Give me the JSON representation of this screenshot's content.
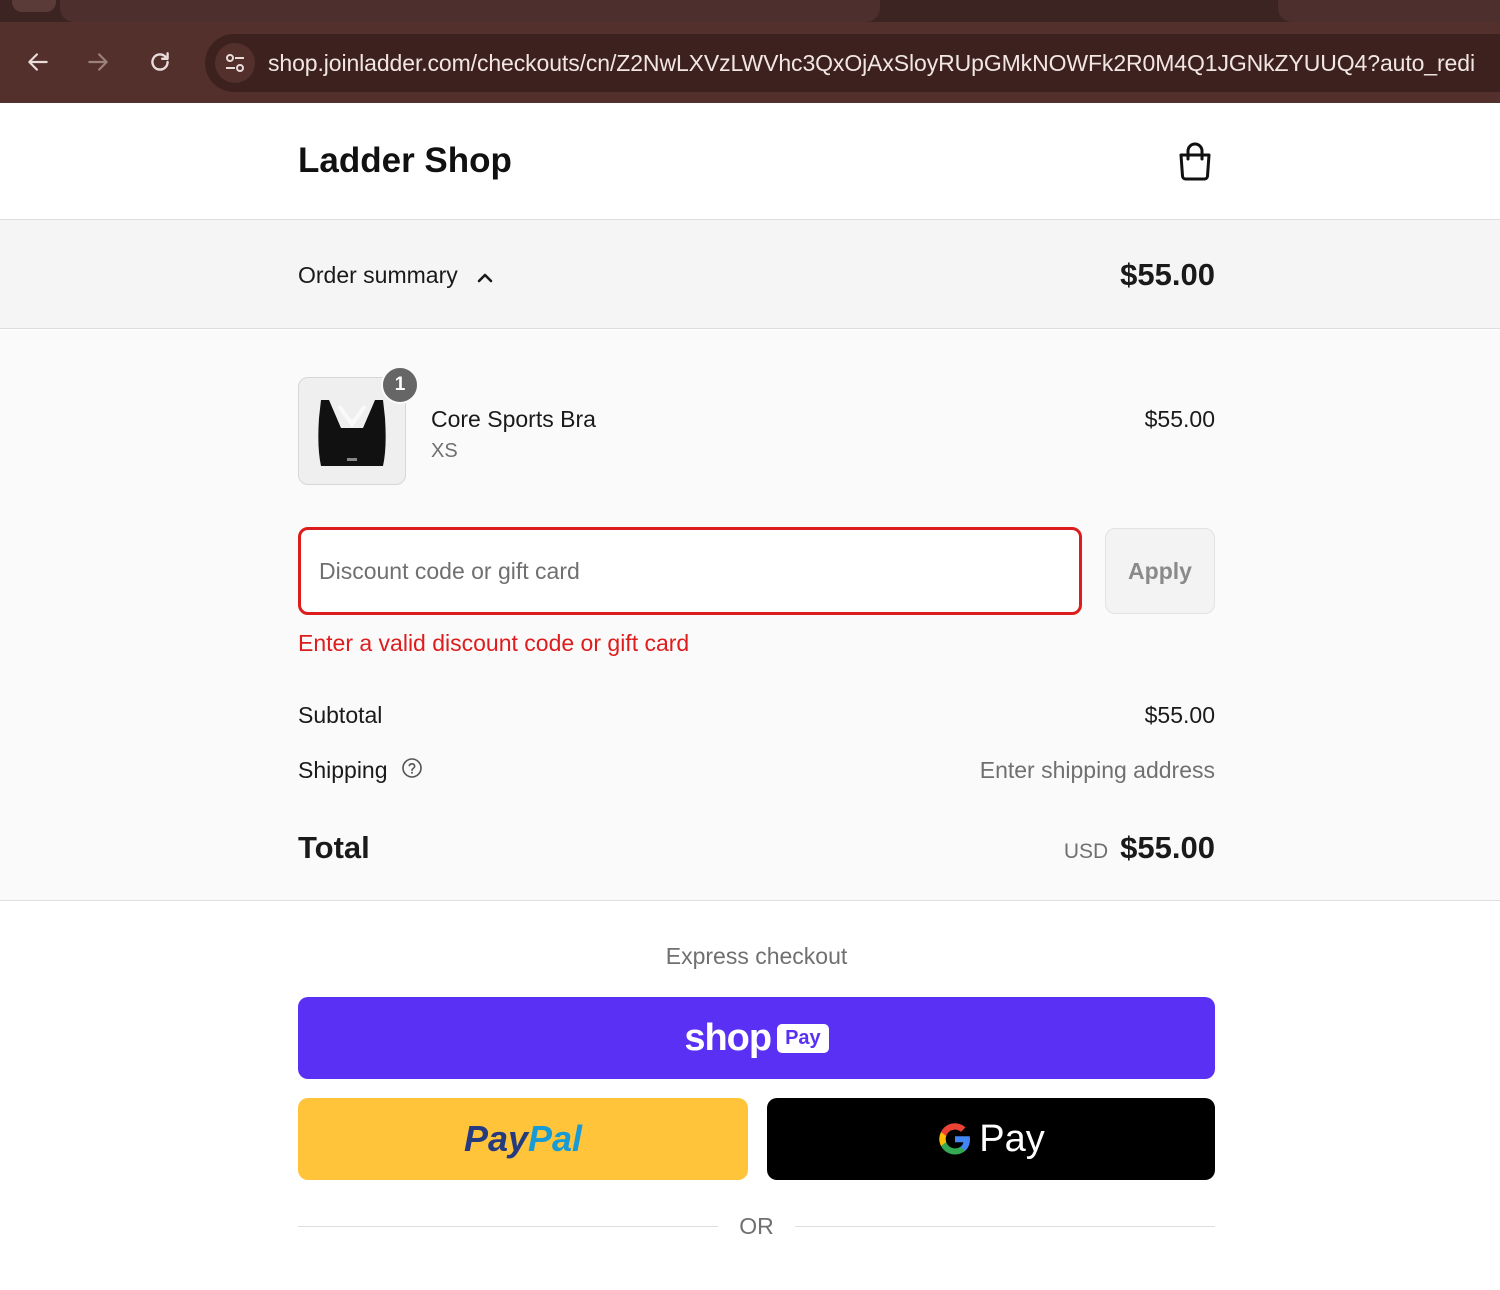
{
  "browser": {
    "url": "shop.joinladder.com/checkouts/cn/Z2NwLXVzLWVhc3QxOjAxSloyRUpGMkNOWFk2R0M4Q1JGNkZYUUQ4?auto_redi"
  },
  "header": {
    "title": "Ladder Shop"
  },
  "order_summary": {
    "label": "Order summary",
    "total": "$55.00"
  },
  "item": {
    "quantity": "1",
    "name": "Core Sports Bra",
    "variant": "XS",
    "price": "$55.00"
  },
  "discount": {
    "placeholder": "Discount code or gift card",
    "apply_label": "Apply",
    "error": "Enter a valid discount code or gift card"
  },
  "totals": {
    "subtotal_label": "Subtotal",
    "subtotal_value": "$55.00",
    "shipping_label": "Shipping",
    "shipping_value": "Enter shipping address",
    "total_label": "Total",
    "currency": "USD",
    "total_value": "$55.00"
  },
  "express": {
    "label": "Express checkout",
    "shop_word": "shop",
    "shop_pay_tag": "Pay",
    "paypal_a": "Pay",
    "paypal_b": "Pal",
    "gpay_text": "Pay",
    "or_text": "OR"
  },
  "colors": {
    "error": "#dd1d1d",
    "shop_pay": "#5a31f4",
    "paypal": "#ffc439",
    "gpay": "#000000"
  }
}
